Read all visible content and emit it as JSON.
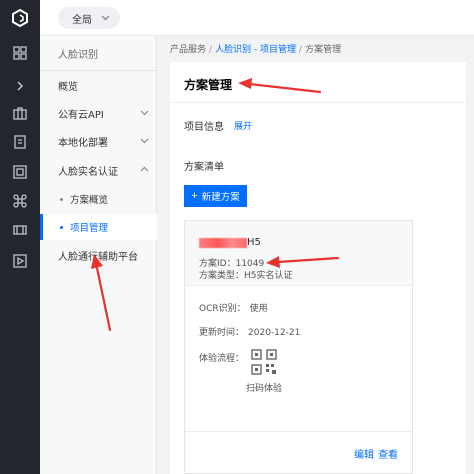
{
  "topbar": {
    "scope_label": "全局"
  },
  "subnav": {
    "title": "人脸识别",
    "items": [
      {
        "label": "概览"
      },
      {
        "label": "公有云API"
      },
      {
        "label": "本地化部署"
      },
      {
        "label": "人脸实名认证"
      },
      {
        "label": "方案概览"
      },
      {
        "label": "项目管理"
      },
      {
        "label": "人脸通行辅助平台"
      }
    ]
  },
  "breadcrumb": {
    "root": "产品服务",
    "sep": "/",
    "mid": "人脸识别 - 项目管理",
    "current": "方案管理"
  },
  "page": {
    "title": "方案管理",
    "info_label": "项目信息",
    "info_toggle": "展开",
    "list_label": "方案清单",
    "new_button": "新建方案"
  },
  "scheme": {
    "name_suffix": "H5",
    "id_label": "方案ID：",
    "id_value": "11049",
    "type_label": "方案类型：",
    "type_value": "H5实名认证",
    "ocr_label": "OCR识别：",
    "ocr_value": "使用",
    "updated_label": "更新时间：",
    "updated_value": "2020-12-21",
    "flow_label": "体验流程：",
    "qr_label": "扫码体验",
    "edit": "编辑",
    "view": "查看"
  },
  "colors": {
    "accent": "#006eff",
    "rail": "#23262d",
    "annotation": "#e8332f"
  },
  "icons": [
    "logo-icon",
    "grid-icon",
    "chevron-right-icon",
    "suitcase-icon",
    "doc-icon",
    "layers-icon",
    "command-icon",
    "film-icon",
    "play-icon"
  ]
}
